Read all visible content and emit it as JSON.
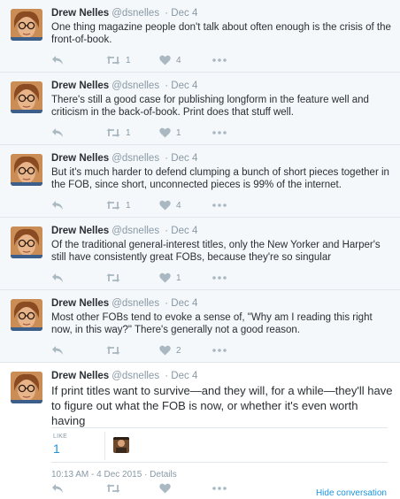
{
  "author": {
    "name": "Drew Nelles",
    "handle": "@dsnelles"
  },
  "tweets": [
    {
      "date": "· Dec 4",
      "text": "One thing magazine people don't talk about often enough is the crisis of the front-of-book.",
      "retweets": "1",
      "likes": "4"
    },
    {
      "date": "· Dec 4",
      "text": "There's still a good case for publishing longform in the feature well and criticism in the back-of-book. Print does that stuff well.",
      "retweets": "1",
      "likes": "1"
    },
    {
      "date": "· Dec 4",
      "text": "But it's much harder to defend clumping a bunch of short pieces together in the FOB, since short, unconnected pieces is 99% of the internet.",
      "retweets": "1",
      "likes": "4"
    },
    {
      "date": "· Dec 4",
      "text": "Of the traditional general-interest titles, only the New Yorker and Harper's still have consistently great FOBs, because they're so singular",
      "retweets": "",
      "likes": "1"
    },
    {
      "date": "· Dec 4",
      "text": "Most other FOBs tend to evoke a sense of, \"Why am I reading this right now, in this way?\" There's generally not a good reason.",
      "retweets": "",
      "likes": "2"
    }
  ],
  "focused": {
    "date": "· Dec 4",
    "text": "If print titles want to survive—and they will, for a while—they'll have to figure out what the FOB is now, or whether it's even worth having",
    "stat_label": "LIKE",
    "stat_value": "1",
    "timestamp": "10:13 AM - 4 Dec 2015 · Details",
    "hide_conversation": "Hide conversation"
  },
  "icons": {
    "reply": "reply-icon",
    "retweet": "retweet-icon",
    "like": "heart-icon",
    "more": "more-icon"
  },
  "colors": {
    "icon": "#aab8c2",
    "link": "#1b95e0",
    "meta": "#8899a6",
    "background": "#f5f8fa"
  }
}
